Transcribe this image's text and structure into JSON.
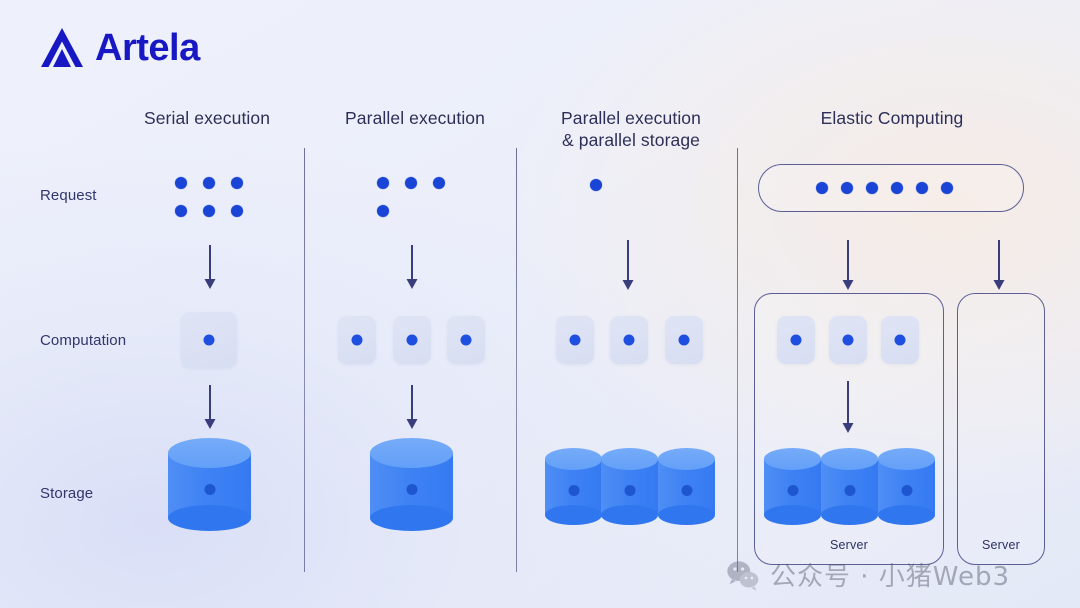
{
  "brand": {
    "name": "Artela",
    "logo_icon": "artela-triangle-logo",
    "color": "#1717c4"
  },
  "rows": [
    {
      "id": "request",
      "label": "Request"
    },
    {
      "id": "computation",
      "label": "Computation"
    },
    {
      "id": "storage",
      "label": "Storage"
    }
  ],
  "columns": [
    {
      "id": "serial-execution",
      "title": "Serial execution",
      "request_dots": 6,
      "computation_units": 1,
      "storage_units": 1
    },
    {
      "id": "parallel-execution",
      "title": "Parallel execution",
      "request_dots": 4,
      "computation_units": 3,
      "storage_units": 1
    },
    {
      "id": "parallel-execution-parallel-storage",
      "title": "Parallel execution\n& parallel storage",
      "title_line1": "Parallel execution",
      "title_line2": "& parallel storage",
      "request_dots": 1,
      "computation_units": 3,
      "storage_units": 3
    },
    {
      "id": "elastic-computing",
      "title": "Elastic Computing",
      "request_dots": 6,
      "computation_units": 3,
      "storage_units": 3,
      "servers": [
        {
          "id": "server-1",
          "label": "Server",
          "populated": true
        },
        {
          "id": "server-2",
          "label": "Server",
          "populated": false
        }
      ]
    }
  ],
  "colors": {
    "dot": "#1944d6",
    "chip": "#dde3f4",
    "cylinder": "#3f82f4",
    "cylinder_top": "#6aa4f8",
    "arrow": "#3a3d7c",
    "divider": "#3c3e6e",
    "text": "#2d2f58",
    "container_border": "#5c5f96"
  },
  "watermark": {
    "icon": "wechat-icon",
    "text": "公众号 · 小猪Web3"
  }
}
